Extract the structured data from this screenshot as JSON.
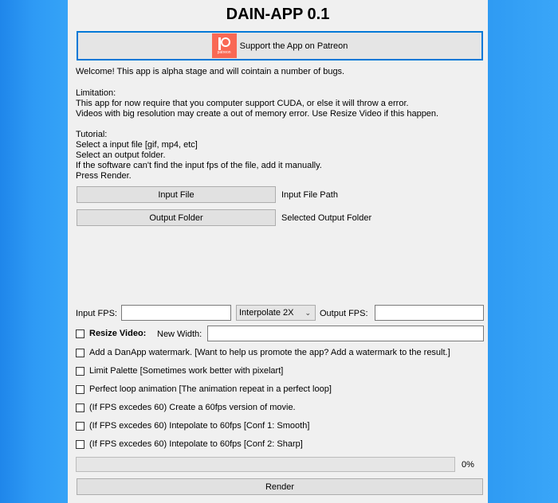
{
  "app": {
    "title": "DAIN-APP 0.1",
    "patreon_button": "Support the App on Patreon",
    "patreon_logo_text": "patreon"
  },
  "info": {
    "welcome": "Welcome! This app is alpha stage and will cointain a number of bugs.",
    "limitation_title": "Limitation:",
    "limitation_1": "This app for now require that you computer support CUDA, or else it will throw a error.",
    "limitation_2": "Videos with big resolution may create a out of memory error. Use Resize Video if this happen.",
    "tutorial_title": "Tutorial:",
    "tutorial_1": "Select a input file [gif, mp4, etc]",
    "tutorial_2": "Select an output folder.",
    "tutorial_3": "If the software can't find the input fps of the file, add it manually.",
    "tutorial_4": "Press Render."
  },
  "files": {
    "input_button": "Input File",
    "input_path": "Input File Path",
    "output_button": "Output Folder",
    "output_path": "Selected Output Folder"
  },
  "fps": {
    "input_label": "Input FPS:",
    "input_value": "",
    "interpolate_selected": "Interpolate 2X",
    "output_label": "Output FPS:",
    "output_value": ""
  },
  "resize": {
    "label": "Resize Video:",
    "checked": false,
    "width_label": "New Width:",
    "width_value": ""
  },
  "options": [
    {
      "label": "Add a DanApp watermark. [Want to help us promote the app? Add a watermark to the result.]",
      "checked": false
    },
    {
      "label": "Limit Palette [Sometimes work better with pixelart]",
      "checked": false
    },
    {
      "label": "Perfect loop animation [The animation repeat in a perfect loop]",
      "checked": false
    },
    {
      "label": "(If FPS excedes 60) Create a 60fps version of movie.",
      "checked": false
    },
    {
      "label": "(If FPS excedes 60) Intepolate to 60fps [Conf 1: Smooth]",
      "checked": false
    },
    {
      "label": "(If FPS excedes 60) Intepolate to 60fps [Conf 2: Sharp]",
      "checked": false
    }
  ],
  "progress": {
    "percent": 0,
    "text": "0%"
  },
  "render_button": "Render",
  "colors": {
    "background": "#2f9bf3",
    "window": "#f0f0f0",
    "patreon": "#f96854",
    "focus_border": "#0078d7"
  }
}
